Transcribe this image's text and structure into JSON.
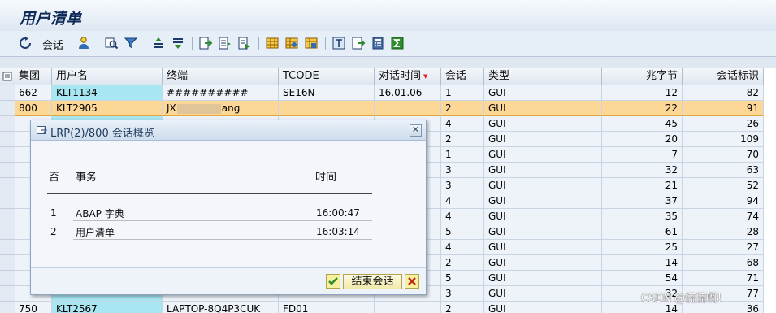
{
  "window": {
    "title": "用户清单"
  },
  "toolbar": {
    "session_label": "会话",
    "icons": [
      "refresh-icon",
      "session-icon",
      "user-icon",
      "find-icon",
      "filter-icon",
      "sort-ascending-icon",
      "sort-descending-icon",
      "export-icon",
      "print-icon",
      "preview-icon",
      "layout-icon",
      "change-layout-icon",
      "save-layout-icon",
      "sum-icon",
      "calculator-icon",
      "abc-icon"
    ]
  },
  "table": {
    "headers": {
      "client": "集团",
      "user": "用户名",
      "terminal": "终端",
      "tcode": "TCODE",
      "dialog_time": "对话时间",
      "sessions": "会话",
      "type": "类型",
      "kbytes": "兆字节",
      "session_id": "会话标识"
    },
    "rows": [
      {
        "client": "662",
        "user": "KLT1134",
        "terminal": "##########",
        "tcode": "SE16N",
        "dialog_time": "16.01.06",
        "sessions": "1",
        "type": "GUI",
        "kbytes": "12",
        "session_id": "82"
      },
      {
        "client": "800",
        "user": "KLT2905",
        "terminal": "JX",
        "terminal_tail": "ang",
        "tcode": "",
        "dialog_time": "",
        "sessions": "2",
        "type": "GUI",
        "kbytes": "22",
        "session_id": "91",
        "selected": true
      },
      {
        "client": "",
        "user": "",
        "terminal": "",
        "tcode": "",
        "dialog_time": "",
        "sessions": "4",
        "type": "GUI",
        "kbytes": "45",
        "session_id": "26"
      },
      {
        "client": "",
        "user": "",
        "terminal": "",
        "tcode": "",
        "dialog_time": "",
        "sessions": "2",
        "type": "GUI",
        "kbytes": "20",
        "session_id": "109"
      },
      {
        "client": "",
        "user": "",
        "terminal": "",
        "tcode": "",
        "dialog_time": "",
        "sessions": "1",
        "type": "GUI",
        "kbytes": "7",
        "session_id": "70"
      },
      {
        "client": "",
        "user": "",
        "terminal": "",
        "tcode": "",
        "dialog_time": "",
        "sessions": "3",
        "type": "GUI",
        "kbytes": "32",
        "session_id": "63"
      },
      {
        "client": "",
        "user": "",
        "terminal": "",
        "tcode": "",
        "dialog_time": "",
        "sessions": "3",
        "type": "GUI",
        "kbytes": "21",
        "session_id": "52"
      },
      {
        "client": "",
        "user": "",
        "terminal": "",
        "tcode": "",
        "dialog_time": "",
        "sessions": "4",
        "type": "GUI",
        "kbytes": "37",
        "session_id": "94"
      },
      {
        "client": "",
        "user": "",
        "terminal": "",
        "tcode": "",
        "dialog_time": "",
        "sessions": "4",
        "type": "GUI",
        "kbytes": "35",
        "session_id": "74"
      },
      {
        "client": "",
        "user": "",
        "terminal": "",
        "tcode": "",
        "dialog_time": "",
        "sessions": "5",
        "type": "GUI",
        "kbytes": "61",
        "session_id": "28"
      },
      {
        "client": "",
        "user": "",
        "terminal": "",
        "tcode": "",
        "dialog_time": "",
        "sessions": "4",
        "type": "GUI",
        "kbytes": "25",
        "session_id": "27"
      },
      {
        "client": "",
        "user": "",
        "terminal": "",
        "tcode": "",
        "dialog_time": "",
        "sessions": "2",
        "type": "GUI",
        "kbytes": "14",
        "session_id": "68"
      },
      {
        "client": "",
        "user": "",
        "terminal": "",
        "tcode": "",
        "dialog_time": "",
        "sessions": "5",
        "type": "GUI",
        "kbytes": "54",
        "session_id": "71"
      },
      {
        "client": "",
        "user": "",
        "terminal": "",
        "tcode": "",
        "dialog_time": "",
        "sessions": "3",
        "type": "GUI",
        "kbytes": "32",
        "session_id": "77"
      },
      {
        "client": "750",
        "user": "KLT2567",
        "terminal": "LAPTOP-8Q4P3CUK",
        "tcode": "FD01",
        "dialog_time": "",
        "sessions": "2",
        "type": "GUI",
        "kbytes": "14",
        "session_id": "36"
      }
    ]
  },
  "popup": {
    "title": "LRP(2)/800 会话概览",
    "col_no": "否",
    "col_task": "事务",
    "col_time": "时间",
    "rows": [
      {
        "no": "1",
        "task": "ABAP 字典",
        "time": "16:00:47"
      },
      {
        "no": "2",
        "task": "用户清单",
        "time": "16:03:14"
      }
    ],
    "end_button": "结束会话"
  },
  "watermark": "CSDN @慌慌啊！",
  "colors": {
    "selected_row": "#fcd795",
    "user_cell": "#a8e6f2",
    "title_text": "#0d2a58"
  }
}
